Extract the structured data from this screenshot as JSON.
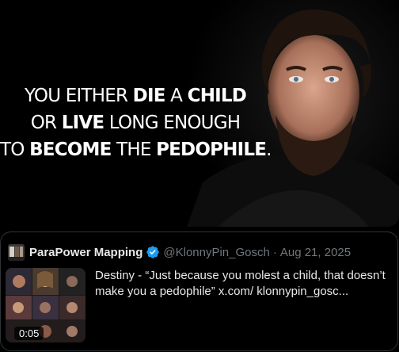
{
  "meme": {
    "line1_a": "YOU EITHER ",
    "line1_b": "DIE",
    "line1_c": " A ",
    "line1_d": "CHILD",
    "line2_a": "OR ",
    "line2_b": "LIVE",
    "line2_c": " LONG ENOUGH",
    "line3_a": "TO ",
    "line3_b": "BECOME",
    "line3_c": " THE ",
    "line3_d": "PEDOPHILE",
    "line3_e": "."
  },
  "quote": {
    "author_name": "ParaPower Mapping",
    "handle": "@KlonnyPin_Gosch",
    "separator": "·",
    "date": "Aug 21, 2025",
    "text": "Destiny - “Just because you molest a child, that doesn’t make you a pedophile”  x.com/ klonnypin_gosc...",
    "video_duration": "0:05"
  },
  "colors": {
    "background": "#000000",
    "border": "#2f3336",
    "muted_text": "#71767b",
    "verified_badge": "#1d9bf0"
  },
  "icons": [
    "verified-badge-icon",
    "avatar-image",
    "video-thumbnail"
  ]
}
